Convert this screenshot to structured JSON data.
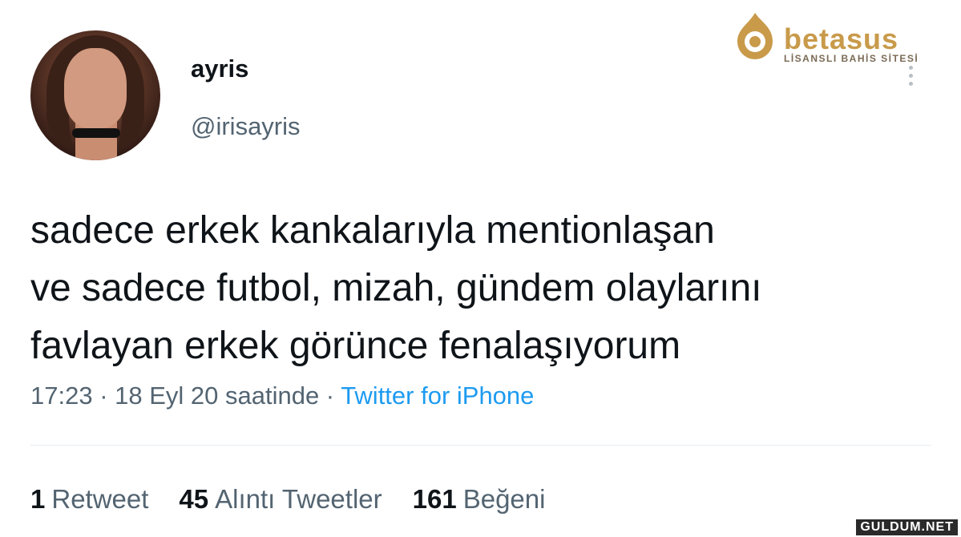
{
  "tweet": {
    "display_name": "ayris",
    "handle": "@irisayris",
    "text": "sadece erkek kankalarıyla mentionlaşan\nve sadece futbol, mizah, gündem olaylarını\nfavlayan erkek görünce fenalaşıyorum",
    "timestamp": "17:23 · 18 Eyl 20 saatinde · ",
    "source": "Twitter for iPhone",
    "stats": {
      "retweets_count": "1",
      "retweets_label": "Retweet",
      "quotes_count": "45",
      "quotes_label": "Alıntı Tweetler",
      "likes_count": "161",
      "likes_label": "Beğeni"
    }
  },
  "watermark": {
    "brand": "betasus",
    "tagline": "LİSANSLI BAHİS SİTESİ",
    "site": "GULDUM.NET"
  },
  "icons": {
    "avatar": "user-avatar",
    "more": "more-vertical-icon",
    "brand_logo": "betasus-logo-icon"
  },
  "colors": {
    "text_primary": "#0f1419",
    "text_secondary": "#536471",
    "link": "#1d9bf0",
    "brand": "#c89a4a"
  }
}
